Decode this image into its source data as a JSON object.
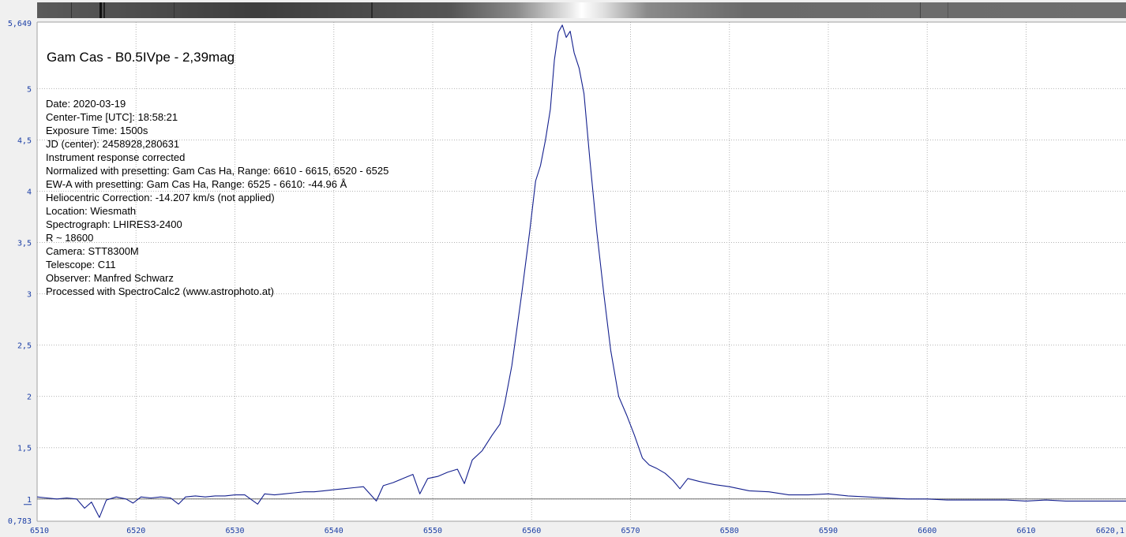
{
  "chart_data": {
    "type": "line",
    "title": "Gam Cas - B0.5IVpe - 2,39mag",
    "info_lines": [
      "Date: 2020-03-19",
      "Center-Time [UTC]: 18:58:21",
      "Exposure Time: 1500s",
      "JD (center): 2458928,280631",
      "Instrument response corrected",
      "Normalized with presetting: Gam Cas Ha, Range: 6610 - 6615, 6520 - 6525",
      "EW-A with presetting: Gam Cas Ha, Range: 6525 - 6610: -44.96 Å",
      "Heliocentric Correction: -14.207 km/s (not applied)",
      "Location: Wiesmath",
      "Spectrograph: LHIRES3-2400",
      "R ~ 18600",
      "Camera: STT8300M",
      "Telescope: C11",
      "Observer: Manfred Schwarz",
      "Processed with SpectroCalc2 (www.astrophoto.at)"
    ],
    "xlim": [
      6510,
      6620.1
    ],
    "ylim": [
      0.783,
      5.649
    ],
    "x_ticks": [
      6510,
      6520,
      6530,
      6540,
      6550,
      6560,
      6570,
      6580,
      6590,
      6600,
      6610,
      6620.1
    ],
    "x_tick_labels": [
      "6510",
      "6520",
      "6530",
      "6540",
      "6550",
      "6560",
      "6570",
      "6580",
      "6590",
      "6600",
      "6610",
      "6620,1"
    ],
    "y_ticks": [
      0.783,
      1,
      1.5,
      2,
      2.5,
      3,
      3.5,
      4,
      4.5,
      5,
      5.649
    ],
    "y_tick_labels": [
      "0,783",
      "1",
      "1,5",
      "2",
      "2,5",
      "3",
      "3,5",
      "4",
      "4,5",
      "5",
      "5,649"
    ],
    "grid": true,
    "reference_line_y": 1,
    "line_color": "#14208e",
    "spectrum_strip_colors": [
      "#2a2a2a",
      "#9a9a9a",
      "#ffffff"
    ],
    "series": [
      {
        "x": [
          6510,
          6511,
          6512,
          6513,
          6514,
          6514.8,
          6515.5,
          6516.3,
          6517,
          6518,
          6519,
          6519.7,
          6520.5,
          6521.5,
          6522.5,
          6523.5,
          6524.3,
          6525,
          6526,
          6527,
          6528,
          6529,
          6530,
          6531,
          6532.3,
          6533,
          6534,
          6535,
          6536,
          6537,
          6538,
          6539,
          6540,
          6541,
          6542,
          6543,
          6544.3,
          6545,
          6546,
          6547,
          6548,
          6548.7,
          6549.5,
          6550.5,
          6551.5,
          6552.5,
          6553.2,
          6554,
          6555,
          6556,
          6556.8,
          6557.3,
          6558,
          6559,
          6559.8,
          6560.4,
          6560.9,
          6561.4,
          6561.9,
          6562.3,
          6562.7,
          6563.1,
          6563.5,
          6563.9,
          6564.3,
          6564.8,
          6565.3,
          6565.9,
          6566.6,
          6567.3,
          6568,
          6568.8,
          6569.6,
          6570.4,
          6571.2,
          6571.9,
          6572.6,
          6573.5,
          6574.3,
          6575,
          6575.8,
          6577,
          6578.5,
          6580,
          6582,
          6584,
          6586,
          6588,
          6590,
          6592,
          6594,
          6596,
          6598,
          6600,
          6602,
          6604,
          6606,
          6608,
          6610,
          6612,
          6614,
          6616,
          6618,
          6620.1
        ],
        "y": [
          1.02,
          1.01,
          1.0,
          1.01,
          1.0,
          0.91,
          0.97,
          0.82,
          0.99,
          1.02,
          1.0,
          0.96,
          1.02,
          1.01,
          1.02,
          1.01,
          0.95,
          1.02,
          1.03,
          1.02,
          1.03,
          1.03,
          1.04,
          1.04,
          0.95,
          1.05,
          1.04,
          1.05,
          1.06,
          1.07,
          1.07,
          1.08,
          1.09,
          1.1,
          1.11,
          1.12,
          0.98,
          1.13,
          1.16,
          1.2,
          1.24,
          1.05,
          1.2,
          1.22,
          1.26,
          1.29,
          1.15,
          1.38,
          1.47,
          1.62,
          1.73,
          1.94,
          2.3,
          3.0,
          3.6,
          4.1,
          4.25,
          4.5,
          4.8,
          5.28,
          5.55,
          5.62,
          5.5,
          5.56,
          5.35,
          5.2,
          4.95,
          4.3,
          3.6,
          3.0,
          2.45,
          2.0,
          1.82,
          1.62,
          1.4,
          1.33,
          1.3,
          1.25,
          1.18,
          1.1,
          1.2,
          1.17,
          1.14,
          1.12,
          1.08,
          1.07,
          1.04,
          1.04,
          1.05,
          1.03,
          1.02,
          1.01,
          1.0,
          1.0,
          0.99,
          0.99,
          0.99,
          0.99,
          0.98,
          0.99,
          0.98,
          0.98,
          0.98,
          0.98
        ]
      }
    ]
  }
}
